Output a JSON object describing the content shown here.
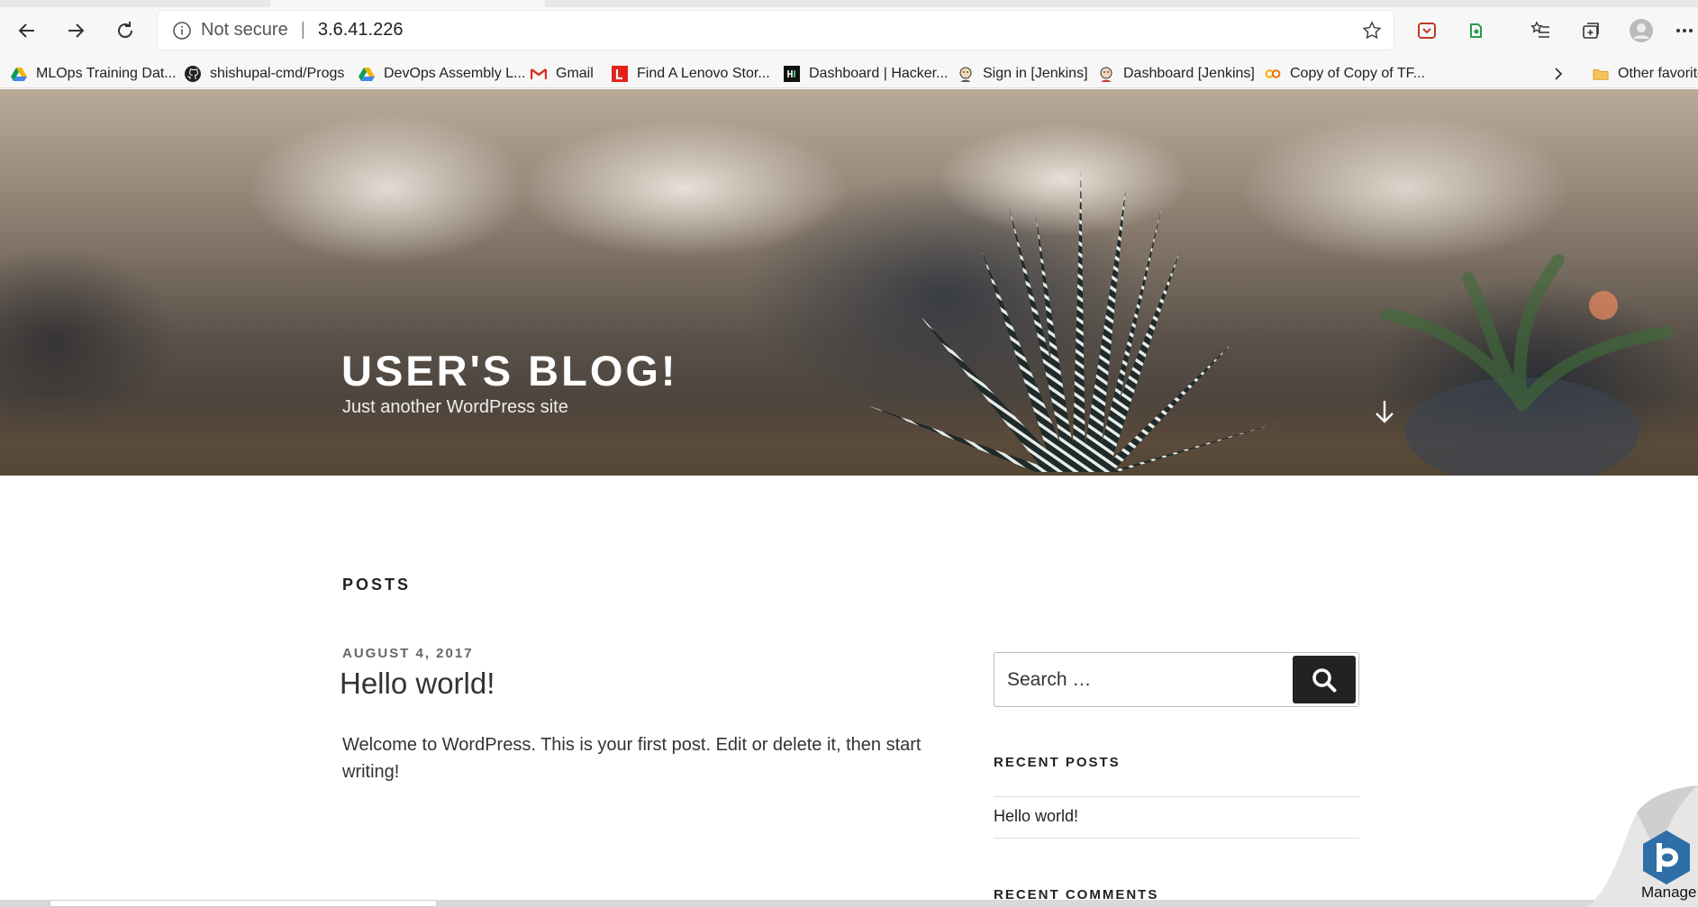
{
  "browser": {
    "security_label": "Not secure",
    "separator": "|",
    "url": "3.6.41.226"
  },
  "bookmarks": [
    {
      "label": "MLOps Training Dat...",
      "icon": "google-drive-icon"
    },
    {
      "label": "shishupal-cmd/Progs",
      "icon": "github-icon"
    },
    {
      "label": "DevOps Assembly L...",
      "icon": "google-drive-icon"
    },
    {
      "label": "Gmail",
      "icon": "gmail-icon"
    },
    {
      "label": "Find A Lenovo Stor...",
      "icon": "lenovo-icon"
    },
    {
      "label": "Dashboard | Hacker...",
      "icon": "hackerrank-icon"
    },
    {
      "label": "Sign in [Jenkins]",
      "icon": "jenkins-icon"
    },
    {
      "label": "Dashboard [Jenkins]",
      "icon": "jenkins-icon"
    },
    {
      "label": "Copy of Copy of TF...",
      "icon": "colab-icon"
    }
  ],
  "bookmarks_overflow": {
    "label": "Other favorite"
  },
  "site": {
    "title": "USER'S BLOG!",
    "description": "Just another WordPress site"
  },
  "posts": {
    "heading": "POSTS",
    "items": [
      {
        "date": "AUGUST 4, 2017",
        "title": "Hello world!",
        "excerpt": "Welcome to WordPress. This is your first post. Edit or delete it, then start writing!"
      }
    ]
  },
  "sidebar": {
    "search_placeholder": "Search …",
    "recent_posts_heading": "RECENT POSTS",
    "recent_posts": [
      "Hello world!"
    ],
    "recent_comments_heading": "RECENT COMMENTS"
  },
  "overlay": {
    "manage_label": "Manage"
  },
  "colors": {
    "search_button": "#222222",
    "hero_text": "#ffffff"
  }
}
